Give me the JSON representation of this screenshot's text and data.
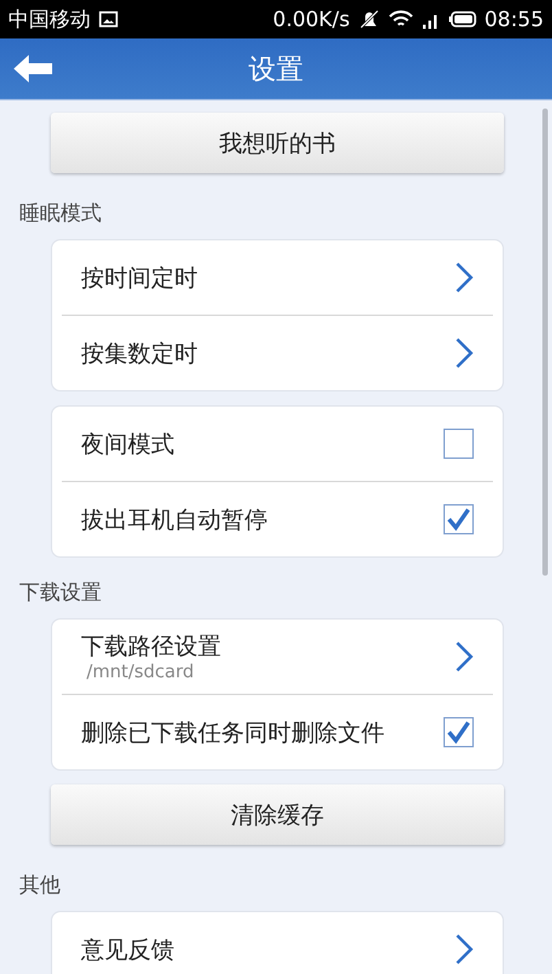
{
  "status_bar": {
    "carrier": "中国移动",
    "speed": "0.00K/s",
    "time": "08:55"
  },
  "header": {
    "title": "设置"
  },
  "sections": [
    {
      "kind": "button",
      "label": "我想听的书"
    },
    {
      "kind": "label",
      "text": "睡眠模式"
    },
    {
      "kind": "card",
      "items": [
        {
          "kind": "link",
          "label": "按时间定时"
        },
        {
          "kind": "link",
          "label": "按集数定时"
        }
      ]
    },
    {
      "kind": "card",
      "items": [
        {
          "kind": "check",
          "label": "夜间模式",
          "checked": false
        },
        {
          "kind": "check",
          "label": "拔出耳机自动暂停",
          "checked": true
        }
      ]
    },
    {
      "kind": "label",
      "text": "下载设置"
    },
    {
      "kind": "card",
      "items": [
        {
          "kind": "link",
          "label": "下载路径设置",
          "sub": "/mnt/sdcard"
        },
        {
          "kind": "check",
          "label": "删除已下载任务同时删除文件",
          "checked": true
        }
      ]
    },
    {
      "kind": "button",
      "label": "清除缓存"
    },
    {
      "kind": "label",
      "text": "其他"
    },
    {
      "kind": "card",
      "items": [
        {
          "kind": "link",
          "label": "意见反馈"
        }
      ]
    }
  ]
}
